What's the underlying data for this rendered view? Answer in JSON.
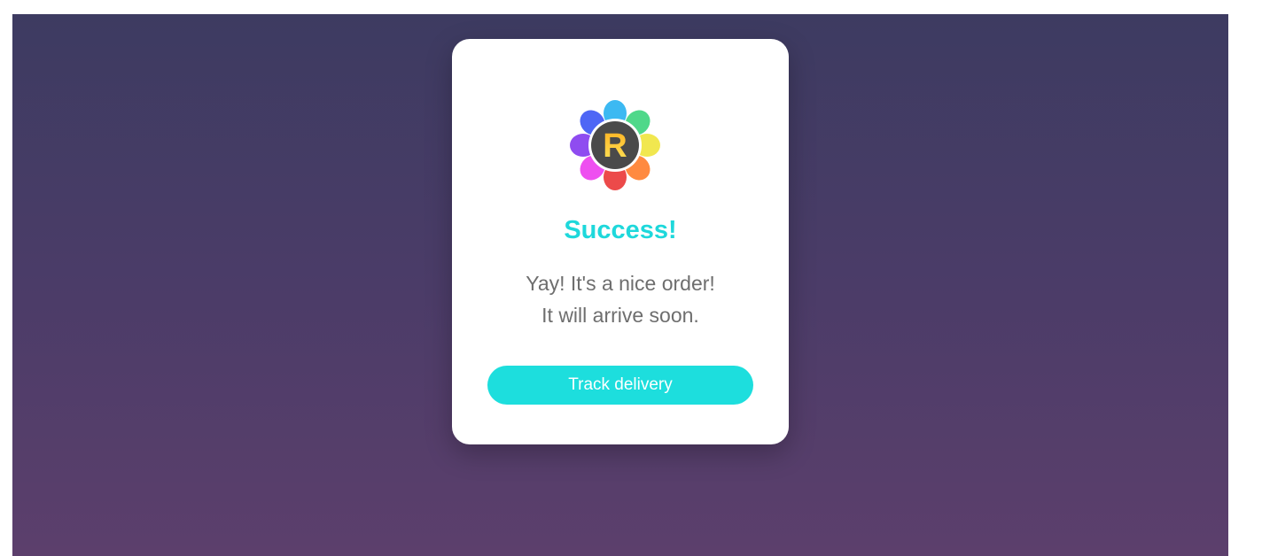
{
  "dialog": {
    "logo_icon": "flower-r-logo-icon",
    "logo_letter": "R",
    "title": "Success!",
    "message_line1": "Yay! It's a nice order!",
    "message_line2": "It will arrive soon.",
    "button_label": "Track delivery"
  },
  "colors": {
    "accent": "#1ddedd",
    "title": "#1ed8db",
    "text": "#6e6e6e",
    "background_top": "#3d3b61",
    "background_bottom": "#5c3f6c"
  }
}
